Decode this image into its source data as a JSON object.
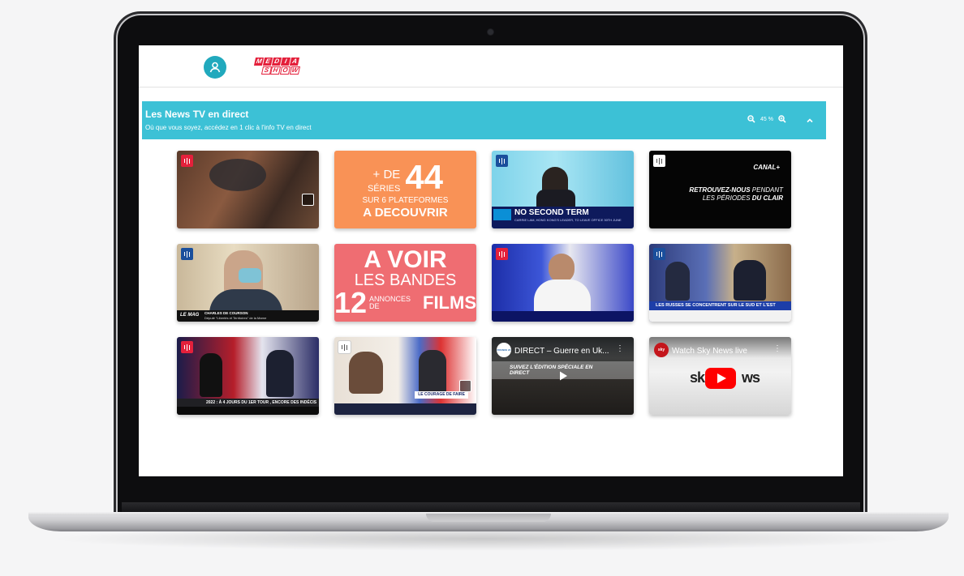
{
  "app": {
    "logo_line1": [
      "M",
      "E",
      "D",
      "I",
      "A"
    ],
    "logo_line2": [
      "S",
      "H",
      "O",
      "W"
    ]
  },
  "section": {
    "title": "Les News TV en direct",
    "subtitle": "Où que vous soyez, accédez en 1 clic à l'info TV en direct",
    "zoom_level": "45 %"
  },
  "tiles": {
    "promo_series": {
      "pre_line1": "+ DE",
      "pre_line2": "SÉRIES",
      "number": "44",
      "line2": "SUR 6 PLATEFORMES",
      "cta": "A DECOUVRIR"
    },
    "promo_films": {
      "line1": "A VOIR",
      "line2": "LES BANDES",
      "number": "12",
      "annonces_line1": "ANNONCES",
      "annonces_line2": "DE",
      "films": "FILMS"
    },
    "canal": {
      "brand": "CANAL+",
      "line1_bold": "RETROUVEZ-NOUS",
      "line1_rest": " PENDANT",
      "line2_rest": "LES PÉRIODES ",
      "line2_bold": "DU CLAIR"
    },
    "euronews": {
      "headline": "NO SECOND TERM",
      "sub": "CARRIE LAM, HONG KONG'S LEADER, TO LEAVE OFFICE 30TH JUNE"
    },
    "lcp": {
      "name": "CHARLES DE COURSON",
      "role": "Député \"Libertés et Territoires\" de la Marne",
      "show": "LE MAG"
    },
    "russia": {
      "headline": "LES RUSSES SE CONCENTRENT SUR LE SUD ET L'EST"
    },
    "debate": {
      "headline": "2022 : À 4 JOURS DU 1ER TOUR , ENCORE DES INDÉCIS"
    },
    "campaign": {
      "headline": "LE COURAGE DE FAIRE"
    },
    "yt_france24": {
      "title": "DIRECT – Guerre en Uk...",
      "overlay": "SUIVEZ L'ÉDITION SPÉCIALE EN DIRECT",
      "channel": "FRANCE 24"
    },
    "yt_sky": {
      "title": "Watch Sky News live",
      "channel": "sky"
    }
  },
  "colors": {
    "banner": "#3cc1d6",
    "accent": "#21a9bd",
    "series_bg": "#f99256",
    "films_bg": "#ef6d72",
    "live_badge_red": "#e4203b",
    "live_badge_blue": "#1a4f9c"
  }
}
